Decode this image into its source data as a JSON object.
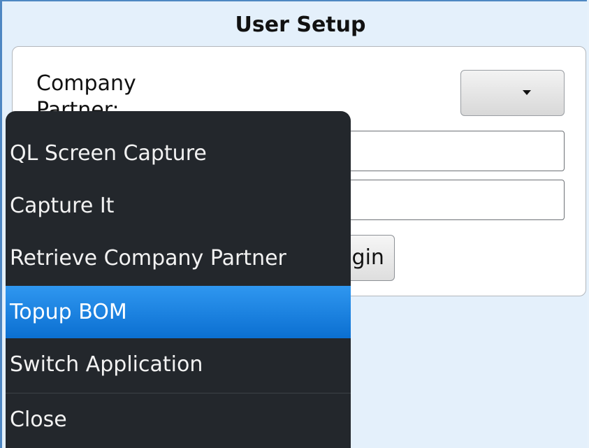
{
  "screen": {
    "title": "User Setup"
  },
  "form": {
    "company_partner_label": "Company Partner:",
    "company_partner_value": "",
    "field_one_value": "",
    "field_two_value": "",
    "login_button_label": "Login"
  },
  "menu": {
    "items": [
      {
        "label": "QL Screen Capture",
        "selected": false
      },
      {
        "label": "Capture It",
        "selected": false
      },
      {
        "label": "Retrieve Company Partner",
        "selected": false
      },
      {
        "label": "Topup BOM",
        "selected": true
      },
      {
        "label": "Switch Application",
        "selected": false
      },
      {
        "label": "Close",
        "selected": false
      }
    ]
  },
  "colors": {
    "background": "#e4f0fb",
    "frame_border": "#4e87c2",
    "menu_background": "#23272c",
    "menu_selected": "#0b6fd1"
  },
  "icons": {
    "dropdown": "caret-down-icon"
  }
}
